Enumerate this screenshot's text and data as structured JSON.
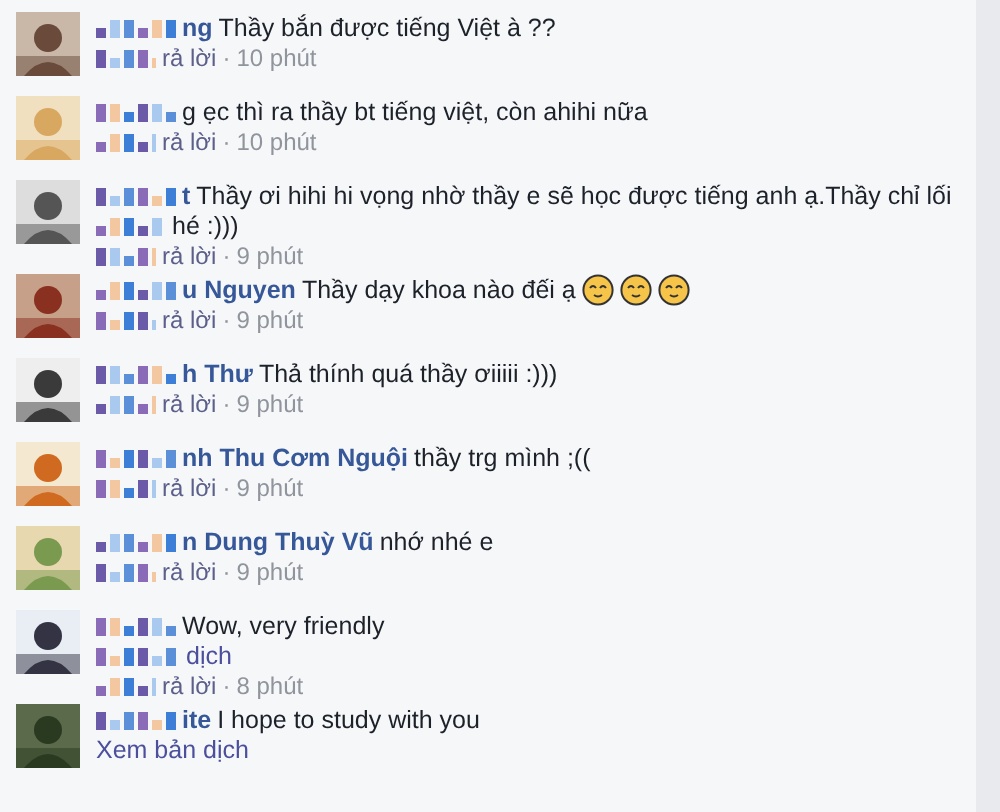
{
  "comments": [
    {
      "name": "ng",
      "lines": [
        "Thầy bắn được tiếng Việt à ??"
      ],
      "reply": "rả lời",
      "separator": "·",
      "time": "10 phút"
    },
    {
      "lines": [
        "g ẹc thì ra thầy bt tiếng việt, còn ahihi nữa"
      ],
      "reply": "rả lời",
      "separator": "·",
      "time": "10 phút"
    },
    {
      "name": "t",
      "lines": [
        "Thầy ơi hihi hi vọng nhờ thầy e sẽ học được tiếng anh ạ.Thầy chỉ lối",
        "hé :)))"
      ],
      "reply": "rả lời",
      "separator": "·",
      "time": "9 phút"
    },
    {
      "name": "u Nguyen",
      "lines": [
        "Thầy dạy khoa nào đếi ạ"
      ],
      "emojis": [
        {
          "kind": "smiley"
        },
        {
          "kind": "smiley"
        },
        {
          "kind": "smiley"
        }
      ],
      "reply": "rả lời",
      "separator": "·",
      "time": "9 phút"
    },
    {
      "name": "h Thư",
      "lines": [
        "Thả thính quá thầy ơiiiii :)))"
      ],
      "reply": "rả lời",
      "separator": "·",
      "time": "9 phút"
    },
    {
      "name": "nh Thu Cơm Nguội",
      "lines": [
        "thầy trg mình ;(("
      ],
      "reply": "rả lời",
      "separator": "·",
      "time": "9 phút"
    },
    {
      "name": "n Dung Thuỳ Vũ",
      "lines": [
        "nhớ nhé e"
      ],
      "reply": "rả lời",
      "separator": "·",
      "time": "9 phút"
    },
    {
      "lines": [
        "Wow, very friendly"
      ],
      "translation_tail": "dịch",
      "reply": "rả lời",
      "separator": "·",
      "time": "8 phút"
    },
    {
      "name": "ite",
      "lines": [
        "I hope to study with you"
      ],
      "translation": "Xem bản dịch"
    }
  ]
}
